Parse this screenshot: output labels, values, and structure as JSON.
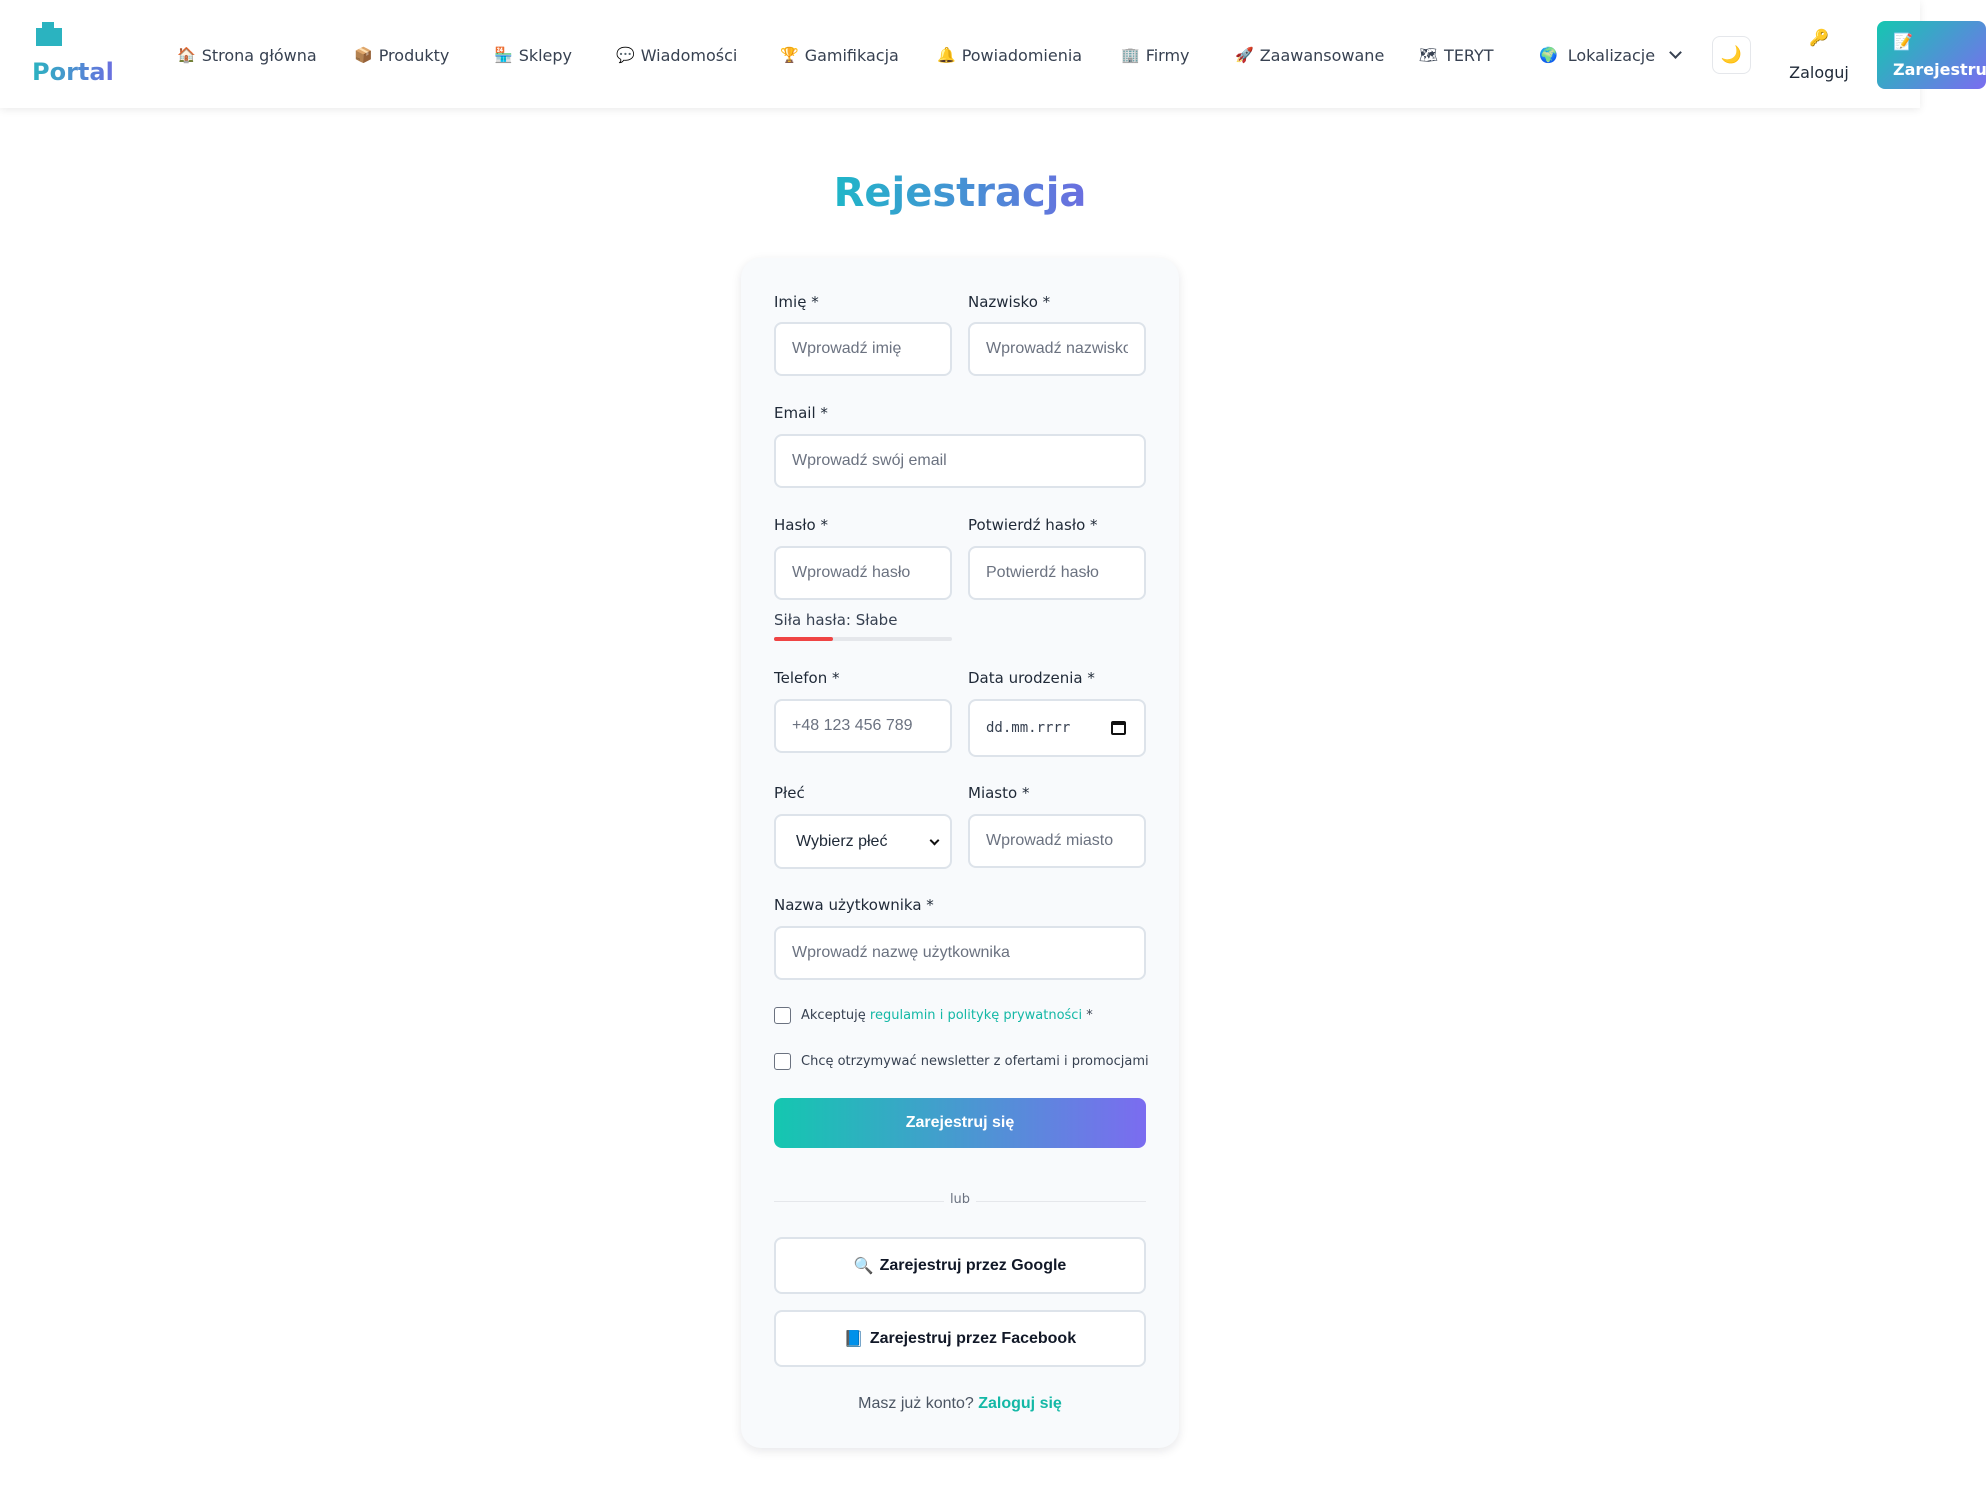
{
  "brand": {
    "name": "Portal"
  },
  "nav": {
    "items": [
      {
        "icon": "🏠",
        "icon_name": "home-icon",
        "label": "Strona główna"
      },
      {
        "icon": "📦",
        "icon_name": "box-icon",
        "label": "Produkty"
      },
      {
        "icon": "🏪",
        "icon_name": "store-icon",
        "label": "Sklepy"
      },
      {
        "icon": "💬",
        "icon_name": "chat-icon",
        "label": "Wiadomości"
      },
      {
        "icon": "🏆",
        "icon_name": "trophy-icon",
        "label": "Gamifikacja"
      },
      {
        "icon": "🔔",
        "icon_name": "bell-icon",
        "label": "Powiadomienia"
      },
      {
        "icon": "🏢",
        "icon_name": "building-icon",
        "label": "Firmy"
      },
      {
        "icon": "🚀",
        "icon_name": "rocket-icon",
        "label": "Zaawansowane"
      },
      {
        "icon": "🗺",
        "icon_name": "map-icon",
        "label": "TERYT"
      },
      {
        "icon": "🌍",
        "icon_name": "globe-icon",
        "label": "Lokalizacje"
      }
    ],
    "theme_icon": "🌙",
    "login": {
      "icon": "🔑",
      "label": "Zaloguj"
    },
    "register": {
      "icon": "📝",
      "label": "Zarejestruj"
    }
  },
  "page": {
    "title": "Rejestracja"
  },
  "form": {
    "first_name": {
      "label": "Imię *",
      "placeholder": "Wprowadź imię"
    },
    "last_name": {
      "label": "Nazwisko *",
      "placeholder": "Wprowadź nazwisko"
    },
    "email": {
      "label": "Email *",
      "placeholder": "Wprowadź swój email"
    },
    "password": {
      "label": "Hasło *",
      "placeholder": "Wprowadź hasło"
    },
    "confirm_password": {
      "label": "Potwierdź hasło *",
      "placeholder": "Potwierdź hasło"
    },
    "password_strength": {
      "text": "Siła hasła: Słabe",
      "level": 0.33,
      "color": "#ef4444"
    },
    "phone": {
      "label": "Telefon *",
      "placeholder": "+48 123 456 789"
    },
    "birth_date": {
      "label": "Data urodzenia *",
      "placeholder": "dd.mm.rrrr"
    },
    "gender": {
      "label": "Płeć",
      "selected": "Wybierz płeć"
    },
    "city": {
      "label": "Miasto *",
      "placeholder": "Wprowadź miasto"
    },
    "username": {
      "label": "Nazwa użytkownika *",
      "placeholder": "Wprowadź nazwę użytkownika"
    },
    "terms": {
      "prefix": "Akceptuję",
      "terms_link": "regulamin",
      "conjunction": "i",
      "privacy_link": "politykę prywatności",
      "required_mark": "*",
      "checked": false
    },
    "newsletter": {
      "label": "Chcę otrzymywać newsletter z ofertami i promocjami",
      "checked": false
    },
    "submit_label": "Zarejestruj się",
    "divider_label": "lub",
    "google": {
      "icon": "🔍",
      "label": "Zarejestruj przez Google"
    },
    "facebook": {
      "icon": "📘",
      "label": "Zarejestruj przez Facebook"
    },
    "footer": {
      "text": "Masz już konto?",
      "link": "Zaloguj się"
    }
  },
  "colors": {
    "accent_teal": "#14c7b0",
    "accent_purple": "#7b6cf0",
    "link": "#14b8a6",
    "strength_weak": "#ef4444"
  }
}
